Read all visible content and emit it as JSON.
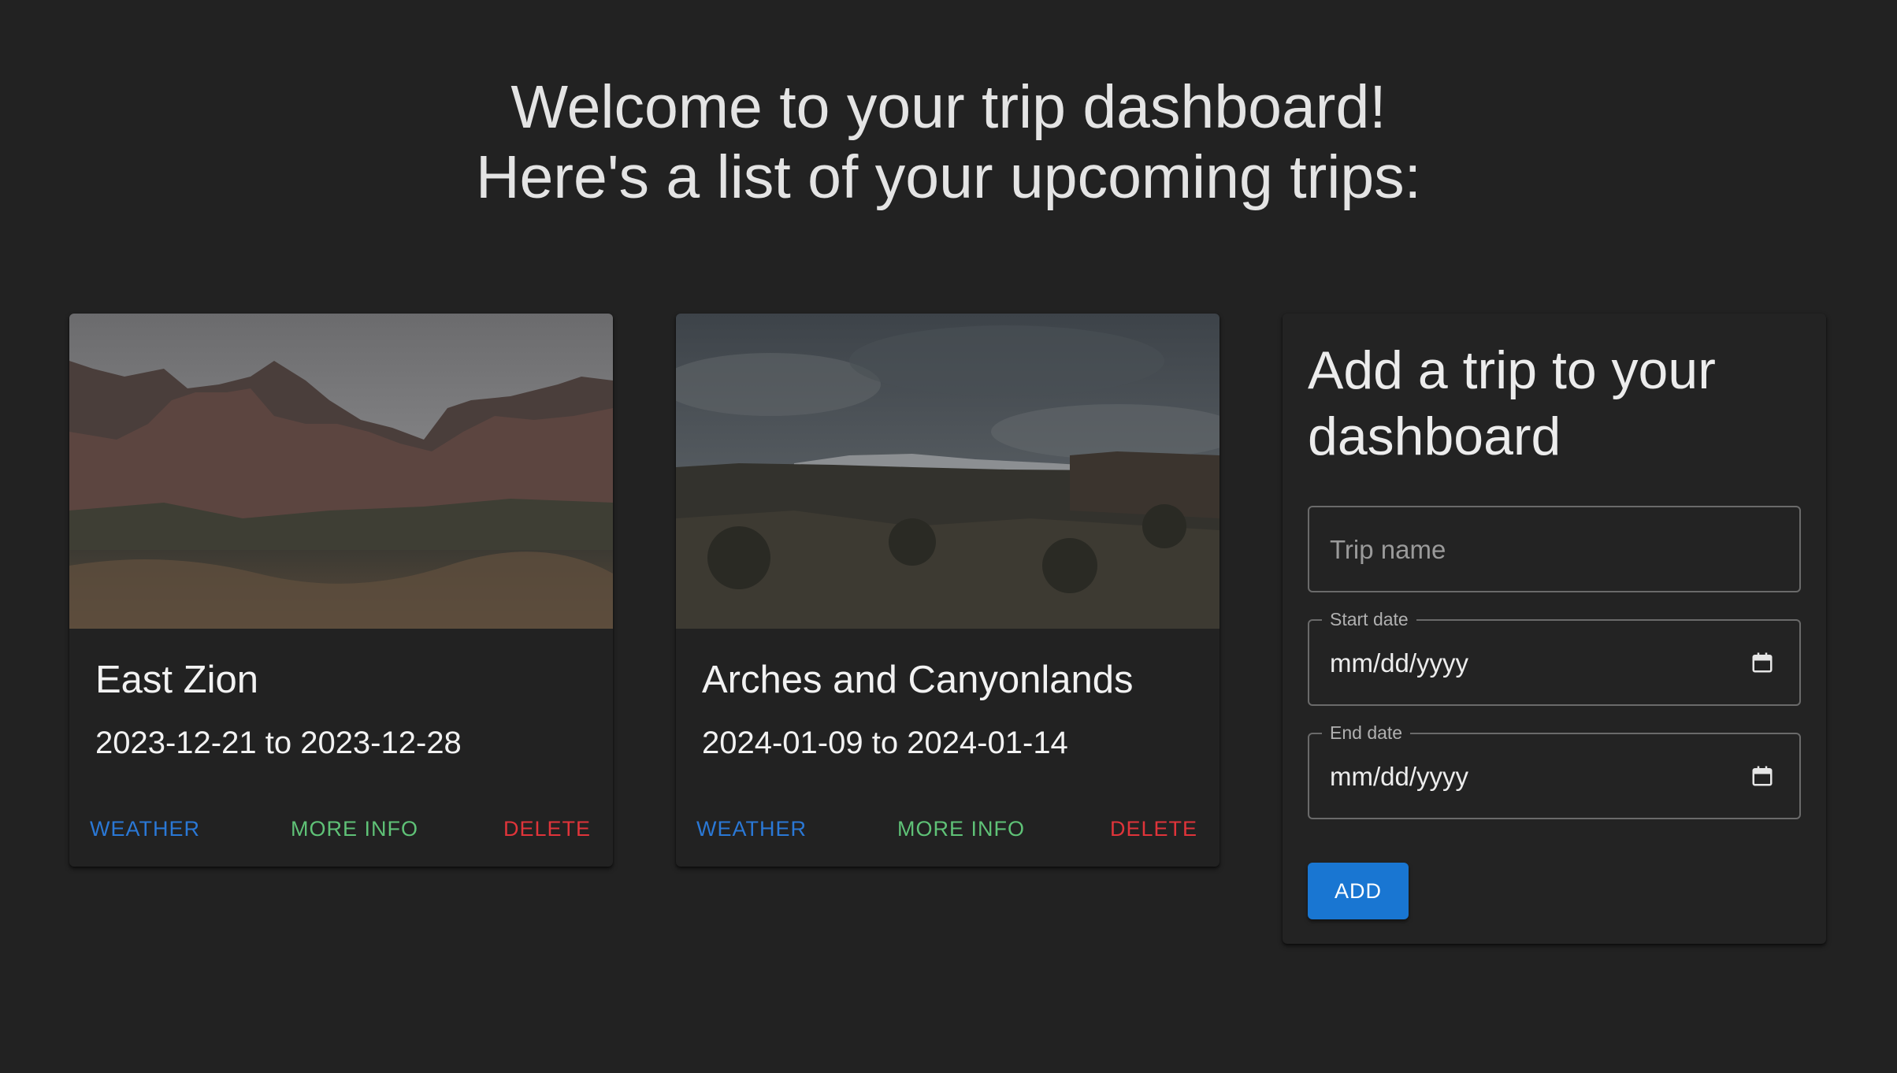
{
  "header": {
    "line1": "Welcome to your trip dashboard!",
    "line2": "Here's a list of your upcoming trips:"
  },
  "trips": [
    {
      "title": "East Zion",
      "dates": "2023-12-21 to 2023-12-28",
      "weather_label": "WEATHER",
      "more_info_label": "MORE INFO",
      "delete_label": "DELETE"
    },
    {
      "title": "Arches and Canyonlands",
      "dates": "2024-01-09 to 2024-01-14",
      "weather_label": "WEATHER",
      "more_info_label": "MORE INFO",
      "delete_label": "DELETE"
    }
  ],
  "form": {
    "title": "Add a trip to your dashboard",
    "trip_name_placeholder": "Trip name",
    "start_date_label": "Start date",
    "start_date_value": "mm/dd/yyyy",
    "end_date_label": "End date",
    "end_date_value": "mm/dd/yyyy",
    "add_label": "ADD"
  },
  "colors": {
    "background": "#222222",
    "weather": "#2a78d6",
    "more_info": "#5fc277",
    "delete": "#e0343a",
    "primary_button": "#1976d2"
  }
}
